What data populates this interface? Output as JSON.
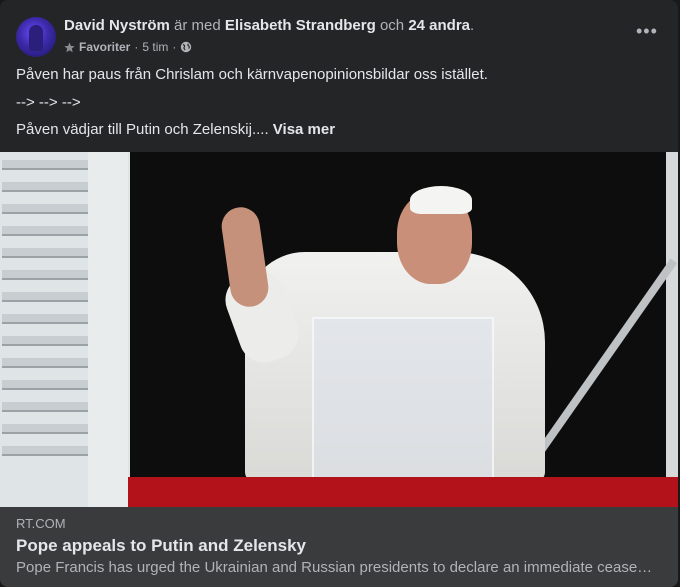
{
  "post": {
    "author": "David Nyström",
    "with_text": "är med",
    "tagged": "Elisabeth Strandberg",
    "and_text": "och",
    "others": "24 andra",
    "period": ".",
    "audience": "Favoriter",
    "separator": "·",
    "time": "5 tim",
    "privacy_icon": "globe-icon",
    "more_icon": "more-horizontal-icon",
    "more_label": "•••",
    "line1": "Påven har paus från Chrislam och kärnvapenopinionsbildar oss istället.",
    "line2": "--> --> -->",
    "line3": "Påven vädjar till Putin och Zelenskij....",
    "see_more": "Visa mer"
  },
  "link": {
    "domain": "RT.COM",
    "title": "Pope appeals to Putin and Zelensky",
    "description": "Pope Francis has urged the Ukrainian and Russian presidents to declare an immediate cease…"
  }
}
